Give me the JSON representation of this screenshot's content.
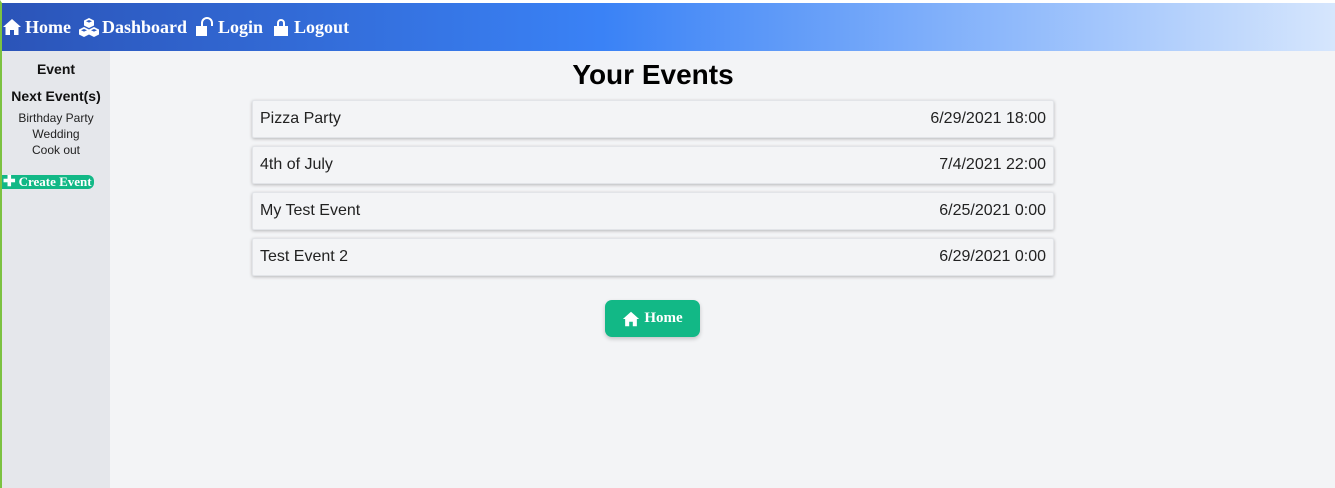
{
  "nav": {
    "home_label": "Home",
    "dashboard_label": "Dashboard",
    "login_label": "Login",
    "logout_label": "Logout"
  },
  "sidebar": {
    "title": "Event",
    "next_heading": "Next Event(s)",
    "items": [
      "Birthday Party",
      "Wedding",
      "Cook out"
    ],
    "create_label": "Create Event",
    "create_icon": "plus-icon"
  },
  "main": {
    "title": "Your Events",
    "events": [
      {
        "name": "Pizza Party",
        "date": "6/29/2021 18:00"
      },
      {
        "name": "4th of July",
        "date": "7/4/2021 22:00"
      },
      {
        "name": "My Test Event",
        "date": "6/25/2021 0:00"
      },
      {
        "name": "Test Event 2",
        "date": "6/29/2021 0:00"
      }
    ],
    "home_button_label": "Home"
  },
  "colors": {
    "accent_green": "#12b886",
    "header_blue": "#3a82f6",
    "sidebar_bg": "#e5e7eb"
  }
}
